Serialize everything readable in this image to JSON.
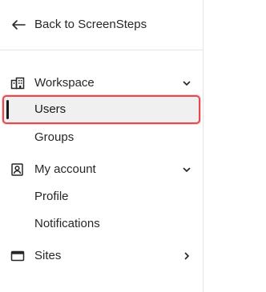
{
  "sidebar": {
    "back": {
      "label": "Back to ScreenSteps",
      "icon": "arrow-left-icon"
    },
    "sections": [
      {
        "label": "Workspace",
        "icon": "building-icon",
        "expanded": true,
        "items": [
          {
            "label": "Users",
            "active": true
          },
          {
            "label": "Groups",
            "active": false
          }
        ]
      },
      {
        "label": "My account",
        "icon": "user-badge-icon",
        "expanded": true,
        "items": [
          {
            "label": "Profile",
            "active": false
          },
          {
            "label": "Notifications",
            "active": false
          }
        ]
      },
      {
        "label": "Sites",
        "icon": "browser-window-icon",
        "expanded": false,
        "items": []
      }
    ]
  },
  "colors": {
    "highlight_border": "#e5484d",
    "active_background": "#f0f0f1",
    "active_indicator": "#18181b",
    "divider": "#e4e4e7"
  }
}
